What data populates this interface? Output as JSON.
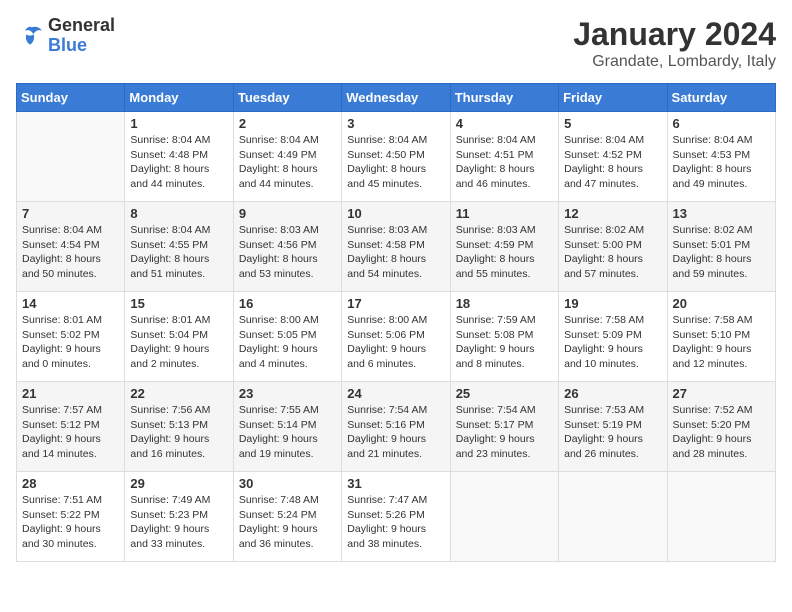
{
  "header": {
    "logo_general": "General",
    "logo_blue": "Blue",
    "month": "January 2024",
    "location": "Grandate, Lombardy, Italy"
  },
  "weekdays": [
    "Sunday",
    "Monday",
    "Tuesday",
    "Wednesday",
    "Thursday",
    "Friday",
    "Saturday"
  ],
  "weeks": [
    [
      {
        "day": "",
        "sunrise": "",
        "sunset": "",
        "daylight": ""
      },
      {
        "day": "1",
        "sunrise": "8:04 AM",
        "sunset": "4:48 PM",
        "daylight": "8 hours and 44 minutes."
      },
      {
        "day": "2",
        "sunrise": "8:04 AM",
        "sunset": "4:49 PM",
        "daylight": "8 hours and 44 minutes."
      },
      {
        "day": "3",
        "sunrise": "8:04 AM",
        "sunset": "4:50 PM",
        "daylight": "8 hours and 45 minutes."
      },
      {
        "day": "4",
        "sunrise": "8:04 AM",
        "sunset": "4:51 PM",
        "daylight": "8 hours and 46 minutes."
      },
      {
        "day": "5",
        "sunrise": "8:04 AM",
        "sunset": "4:52 PM",
        "daylight": "8 hours and 47 minutes."
      },
      {
        "day": "6",
        "sunrise": "8:04 AM",
        "sunset": "4:53 PM",
        "daylight": "8 hours and 49 minutes."
      }
    ],
    [
      {
        "day": "7",
        "sunrise": "8:04 AM",
        "sunset": "4:54 PM",
        "daylight": "8 hours and 50 minutes."
      },
      {
        "day": "8",
        "sunrise": "8:04 AM",
        "sunset": "4:55 PM",
        "daylight": "8 hours and 51 minutes."
      },
      {
        "day": "9",
        "sunrise": "8:03 AM",
        "sunset": "4:56 PM",
        "daylight": "8 hours and 53 minutes."
      },
      {
        "day": "10",
        "sunrise": "8:03 AM",
        "sunset": "4:58 PM",
        "daylight": "8 hours and 54 minutes."
      },
      {
        "day": "11",
        "sunrise": "8:03 AM",
        "sunset": "4:59 PM",
        "daylight": "8 hours and 55 minutes."
      },
      {
        "day": "12",
        "sunrise": "8:02 AM",
        "sunset": "5:00 PM",
        "daylight": "8 hours and 57 minutes."
      },
      {
        "day": "13",
        "sunrise": "8:02 AM",
        "sunset": "5:01 PM",
        "daylight": "8 hours and 59 minutes."
      }
    ],
    [
      {
        "day": "14",
        "sunrise": "8:01 AM",
        "sunset": "5:02 PM",
        "daylight": "9 hours and 0 minutes."
      },
      {
        "day": "15",
        "sunrise": "8:01 AM",
        "sunset": "5:04 PM",
        "daylight": "9 hours and 2 minutes."
      },
      {
        "day": "16",
        "sunrise": "8:00 AM",
        "sunset": "5:05 PM",
        "daylight": "9 hours and 4 minutes."
      },
      {
        "day": "17",
        "sunrise": "8:00 AM",
        "sunset": "5:06 PM",
        "daylight": "9 hours and 6 minutes."
      },
      {
        "day": "18",
        "sunrise": "7:59 AM",
        "sunset": "5:08 PM",
        "daylight": "9 hours and 8 minutes."
      },
      {
        "day": "19",
        "sunrise": "7:58 AM",
        "sunset": "5:09 PM",
        "daylight": "9 hours and 10 minutes."
      },
      {
        "day": "20",
        "sunrise": "7:58 AM",
        "sunset": "5:10 PM",
        "daylight": "9 hours and 12 minutes."
      }
    ],
    [
      {
        "day": "21",
        "sunrise": "7:57 AM",
        "sunset": "5:12 PM",
        "daylight": "9 hours and 14 minutes."
      },
      {
        "day": "22",
        "sunrise": "7:56 AM",
        "sunset": "5:13 PM",
        "daylight": "9 hours and 16 minutes."
      },
      {
        "day": "23",
        "sunrise": "7:55 AM",
        "sunset": "5:14 PM",
        "daylight": "9 hours and 19 minutes."
      },
      {
        "day": "24",
        "sunrise": "7:54 AM",
        "sunset": "5:16 PM",
        "daylight": "9 hours and 21 minutes."
      },
      {
        "day": "25",
        "sunrise": "7:54 AM",
        "sunset": "5:17 PM",
        "daylight": "9 hours and 23 minutes."
      },
      {
        "day": "26",
        "sunrise": "7:53 AM",
        "sunset": "5:19 PM",
        "daylight": "9 hours and 26 minutes."
      },
      {
        "day": "27",
        "sunrise": "7:52 AM",
        "sunset": "5:20 PM",
        "daylight": "9 hours and 28 minutes."
      }
    ],
    [
      {
        "day": "28",
        "sunrise": "7:51 AM",
        "sunset": "5:22 PM",
        "daylight": "9 hours and 30 minutes."
      },
      {
        "day": "29",
        "sunrise": "7:49 AM",
        "sunset": "5:23 PM",
        "daylight": "9 hours and 33 minutes."
      },
      {
        "day": "30",
        "sunrise": "7:48 AM",
        "sunset": "5:24 PM",
        "daylight": "9 hours and 36 minutes."
      },
      {
        "day": "31",
        "sunrise": "7:47 AM",
        "sunset": "5:26 PM",
        "daylight": "9 hours and 38 minutes."
      },
      {
        "day": "",
        "sunrise": "",
        "sunset": "",
        "daylight": ""
      },
      {
        "day": "",
        "sunrise": "",
        "sunset": "",
        "daylight": ""
      },
      {
        "day": "",
        "sunrise": "",
        "sunset": "",
        "daylight": ""
      }
    ]
  ],
  "labels": {
    "sunrise": "Sunrise:",
    "sunset": "Sunset:",
    "daylight": "Daylight hours"
  }
}
